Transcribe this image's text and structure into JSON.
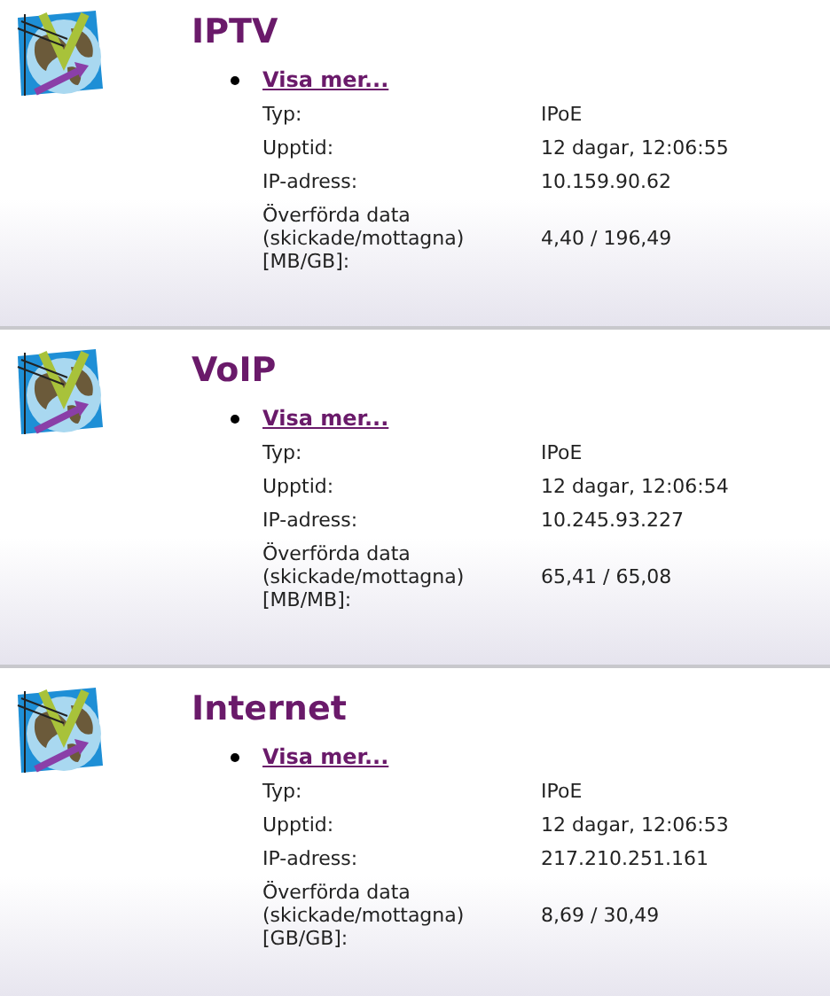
{
  "sections": [
    {
      "title": "IPTV",
      "link": "Visa mer...",
      "rows": [
        {
          "label": "Typ:",
          "value": "IPoE"
        },
        {
          "label": "Upptid:",
          "value": "12 dagar, 12:06:55"
        },
        {
          "label": "IP-adress:",
          "value": "10.159.90.62"
        },
        {
          "label": "Överförda data\n(skickade/mottagna)\n[MB/GB]:",
          "value": "4,40 / 196,49"
        }
      ]
    },
    {
      "title": "VoIP",
      "link": "Visa mer...",
      "rows": [
        {
          "label": "Typ:",
          "value": "IPoE"
        },
        {
          "label": "Upptid:",
          "value": "12 dagar, 12:06:54"
        },
        {
          "label": "IP-adress:",
          "value": "10.245.93.227"
        },
        {
          "label": "Överförda data\n(skickade/mottagna)\n[MB/MB]:",
          "value": "65,41 / 65,08"
        }
      ]
    },
    {
      "title": "Internet",
      "link": "Visa mer...",
      "rows": [
        {
          "label": "Typ:",
          "value": "IPoE"
        },
        {
          "label": "Upptid:",
          "value": "12 dagar, 12:06:53"
        },
        {
          "label": "IP-adress:",
          "value": "217.210.251.161"
        },
        {
          "label": "Överförda data\n(skickade/mottagna)\n[GB/GB]:",
          "value": "8,69 / 30,49"
        }
      ]
    }
  ]
}
